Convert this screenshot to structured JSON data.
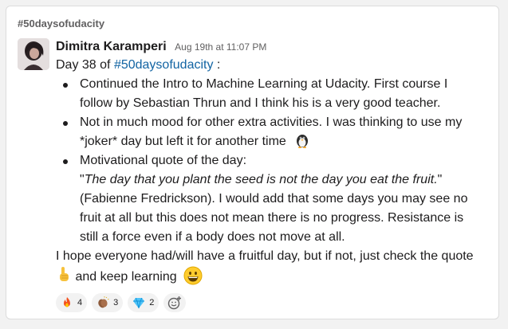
{
  "channel": {
    "name": "#50daysofudacity"
  },
  "message": {
    "author": "Dimitra Karamperi",
    "timestamp": "Aug 19th at 11:07 PM",
    "intro_prefix": "Day 38 of ",
    "intro_link": "#50daysofudacity",
    "intro_suffix": " :",
    "bullets": [
      {
        "line1": "Continued the Intro to Machine Learning at Udacity. First course I",
        "line2": "follow by Sebastian Thrun and I think his is a very good teacher."
      },
      {
        "line1": "Not in much mood for other extra activities. I was thinking to use my",
        "line2": "*joker* day but left it for another time"
      },
      {
        "line1": "Motivational quote of the day:",
        "quote_open": "\"",
        "quote_text": "The day that you plant the seed is not the day you eat the fruit.",
        "quote_close": "\"",
        "line3": "(Fabienne Fredrickson). I would add that some days you may see no",
        "line4": "fruit at all but this does not mean there is no progress. Resistance is",
        "line5": "still a force even if a body does not move at all."
      }
    ],
    "closing_line1": "I hope everyone had/will have a fruitful day, but if not, just check the quote",
    "closing_line2": " and keep learning"
  },
  "reactions": [
    {
      "emoji": "fire-emoji",
      "count": "4"
    },
    {
      "emoji": "clap-emoji",
      "count": "3"
    },
    {
      "emoji": "gem-emoji",
      "count": "2"
    }
  ],
  "colors": {
    "link": "#1264a3",
    "muted": "#616061",
    "text": "#1d1c1d"
  }
}
